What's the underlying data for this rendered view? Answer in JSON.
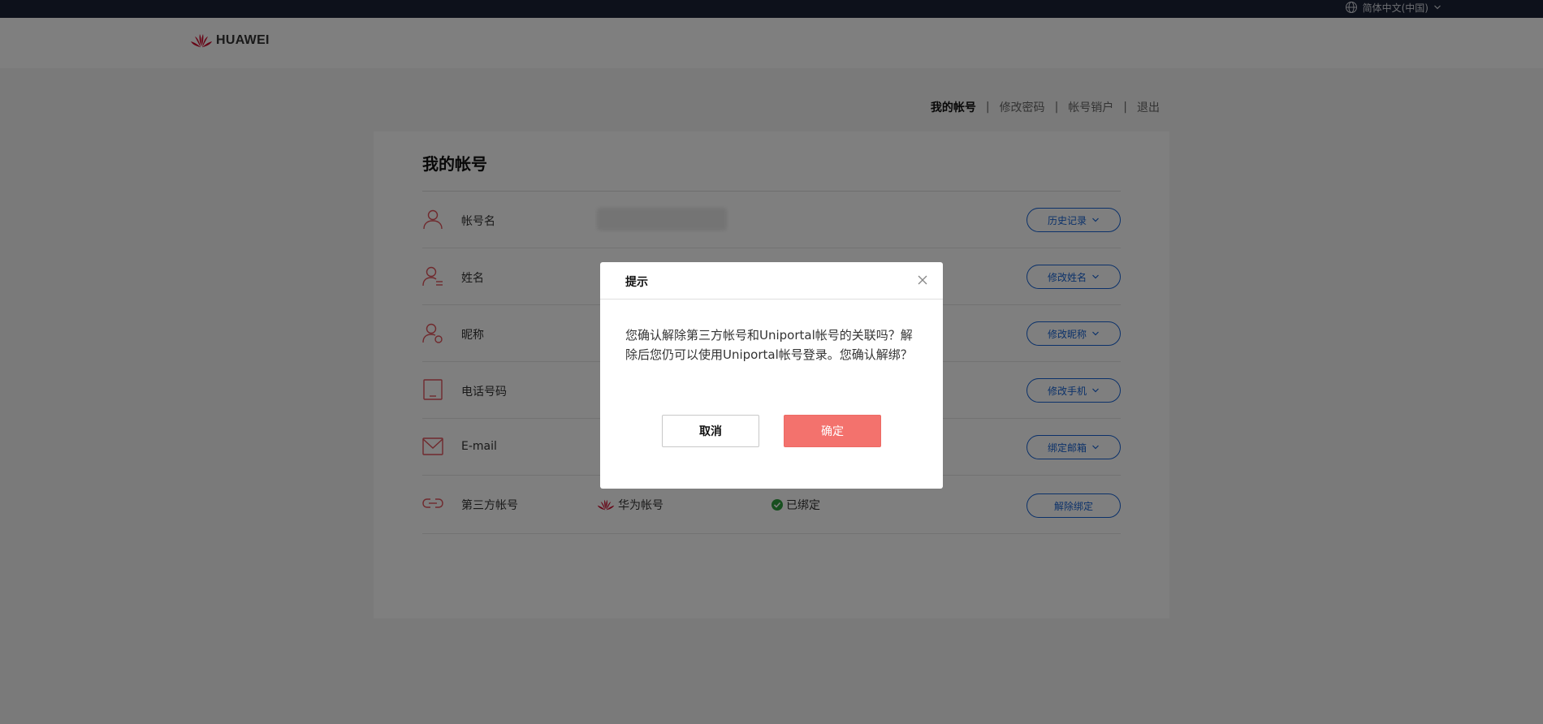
{
  "topbar": {
    "language": "简体中文(中国)"
  },
  "header": {
    "brand": "HUAWEI"
  },
  "subnav": {
    "items": [
      "我的帐号",
      "修改密码",
      "帐号销户",
      "退出"
    ],
    "separator": "|"
  },
  "account": {
    "title": "我的帐号",
    "rows": [
      {
        "label": "帐号名",
        "value": "",
        "button": "历史记录"
      },
      {
        "label": "姓名",
        "value": "",
        "button": "修改姓名"
      },
      {
        "label": "昵称",
        "value": "",
        "button": "修改昵称"
      },
      {
        "label": "电话号码",
        "value": "",
        "button": "修改手机"
      },
      {
        "label": "E-mail",
        "value": "",
        "button": "绑定邮箱"
      },
      {
        "label": "第三方帐号",
        "value": "华为帐号",
        "status": "已绑定",
        "button": "解除绑定"
      }
    ]
  },
  "dialog": {
    "title": "提示",
    "message": "您确认解除第三方帐号和Uniportal帐号的关联吗？解除后您仍可以使用Uniportal帐号登录。您确认解绑？",
    "cancel": "取消",
    "confirm": "确定"
  },
  "colors": {
    "topbar": "#1b2336",
    "accent_blue": "#1763d5",
    "brand_red": "#cf0a2c",
    "icon_red": "#e0535a",
    "confirm_button": "#f3726d",
    "status_green": "#2e9e3e"
  }
}
